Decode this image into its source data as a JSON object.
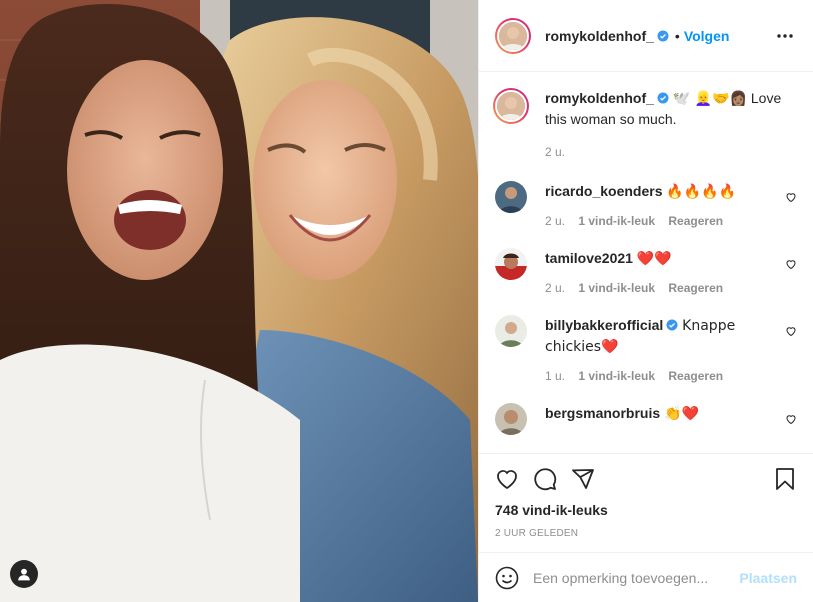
{
  "colors": {
    "accent": "#0095f6",
    "muted": "#8e8e8e",
    "text": "#262626",
    "post_button_disabled": "#b2dffc",
    "border": "#efefef"
  },
  "header": {
    "username": "romykoldenhof_",
    "verified": true,
    "separator": "•",
    "follow_label": "Volgen",
    "more_icon": "more-horizontal-icon"
  },
  "caption": {
    "username": "romykoldenhof_",
    "verified": true,
    "emojis": "🕊️ 👱‍♀️🤝👩🏽",
    "text": "Love this woman so much.",
    "time": "2 u."
  },
  "comments": [
    {
      "username": "ricardo_koenders",
      "verified": false,
      "text": "🔥🔥🔥🔥",
      "time": "2 u.",
      "likes": "1 vind-ik-leuk",
      "reply": "Reageren"
    },
    {
      "username": "tamilove2021",
      "verified": false,
      "text": "❤️❤️",
      "time": "2 u.",
      "likes": "1 vind-ik-leuk",
      "reply": "Reageren"
    },
    {
      "username": "billybakkerofficial",
      "verified": true,
      "text": "Knappe chickies❤️",
      "time": "1 u.",
      "likes": "1 vind-ik-leuk",
      "reply": "Reageren"
    },
    {
      "username": "bergsmanorbruis",
      "verified": false,
      "text": "👏❤️",
      "time": "",
      "likes": "",
      "reply": ""
    }
  ],
  "actions": {
    "like_icon": "heart-icon",
    "comment_icon": "comment-icon",
    "share_icon": "share-icon",
    "save_icon": "bookmark-icon",
    "likes_count": "748 vind-ik-leuks",
    "posted_time": "2 UUR GELEDEN"
  },
  "add_comment": {
    "emoji_icon": "emoji-icon",
    "placeholder": "Een opmerking toevoegen...",
    "post_label": "Plaatsen"
  },
  "photo": {
    "tag_icon": "user-tag-icon"
  }
}
